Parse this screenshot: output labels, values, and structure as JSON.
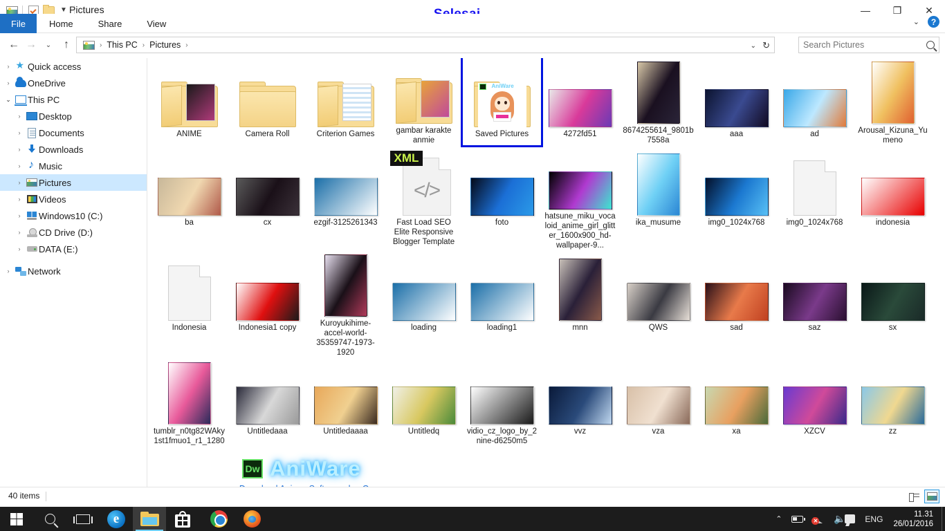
{
  "window": {
    "title": "Pictures",
    "overlay_annotation": "Selesai .......",
    "overlay_color": "#1510f0",
    "quick_access_icons": [
      "pictures-icon",
      "checklist-icon",
      "folder-icon",
      "dropdown-caret"
    ],
    "controls": {
      "minimize": "—",
      "maximize": "❐",
      "close": "✕"
    }
  },
  "ribbon": {
    "tabs": [
      {
        "label": "File",
        "active": true
      },
      {
        "label": "Home",
        "active": false
      },
      {
        "label": "Share",
        "active": false
      },
      {
        "label": "View",
        "active": false
      }
    ],
    "collapse_caret": "⌄",
    "help_label": "?"
  },
  "addressbar": {
    "back": "←",
    "forward": "→",
    "recent": "⌄",
    "up": "↑",
    "crumbs": [
      "This PC",
      "Pictures"
    ],
    "separator": "›",
    "dropdown_caret": "⌄",
    "refresh": "↻"
  },
  "search": {
    "placeholder": "Search Pictures",
    "value": "",
    "icon": "search-icon"
  },
  "sidebar": {
    "items": [
      {
        "label": "Quick access",
        "level": 1,
        "arrow": "›",
        "icon": "star-icon",
        "selected": false
      },
      {
        "label": "OneDrive",
        "level": 1,
        "arrow": "›",
        "icon": "cloud-icon",
        "selected": false
      },
      {
        "label": "This PC",
        "level": 1,
        "arrow": "⌄",
        "icon": "computer-icon",
        "selected": false,
        "expanded": true
      },
      {
        "label": "Desktop",
        "level": 2,
        "arrow": "›",
        "icon": "desktop-icon",
        "selected": false
      },
      {
        "label": "Documents",
        "level": 2,
        "arrow": "›",
        "icon": "documents-icon",
        "selected": false
      },
      {
        "label": "Downloads",
        "level": 2,
        "arrow": "›",
        "icon": "downloads-icon",
        "selected": false
      },
      {
        "label": "Music",
        "level": 2,
        "arrow": "›",
        "icon": "music-icon",
        "selected": false
      },
      {
        "label": "Pictures",
        "level": 2,
        "arrow": "›",
        "icon": "pictures-icon",
        "selected": true
      },
      {
        "label": "Videos",
        "level": 2,
        "arrow": "›",
        "icon": "videos-icon",
        "selected": false
      },
      {
        "label": "Windows10 (C:)",
        "level": 2,
        "arrow": "›",
        "icon": "windows-drive-icon",
        "selected": false
      },
      {
        "label": "CD Drive (D:)",
        "level": 2,
        "arrow": "›",
        "icon": "cd-drive-icon",
        "selected": false
      },
      {
        "label": "DATA (E:)",
        "level": 2,
        "arrow": "›",
        "icon": "hard-drive-icon",
        "selected": false
      },
      {
        "label": "Network",
        "level": 1,
        "arrow": "›",
        "icon": "network-icon",
        "selected": false,
        "spaced": true
      }
    ]
  },
  "files": {
    "rows": [
      [
        {
          "name": "ANIME",
          "type": "folder",
          "variant": "open-image",
          "colors": [
            "#1a1a1a",
            "#b03a7a"
          ]
        },
        {
          "name": "Camera Roll",
          "type": "folder",
          "variant": "empty",
          "colors": []
        },
        {
          "name": "Criterion Games",
          "type": "folder",
          "variant": "docs",
          "colors": [
            "#ffffff",
            "#2b86d4"
          ]
        },
        {
          "name": "gambar karakte anmie",
          "type": "folder",
          "variant": "open-image",
          "colors": [
            "#e8a33a",
            "#c04a9a"
          ]
        },
        {
          "name": "Saved Pictures",
          "type": "folder",
          "variant": "thumbnail-umaru",
          "selected": true,
          "colors": [
            "#ffffff",
            "#e89a5a"
          ]
        },
        {
          "name": "4272fd51",
          "type": "image",
          "colors": [
            "#e8e8e8",
            "#d93a9a",
            "#6a3ab5"
          ]
        },
        {
          "name": "8674255614_9801b7558a",
          "type": "image",
          "tall": true,
          "colors": [
            "#d8c8a8",
            "#1a1020",
            "#2a2438"
          ]
        },
        {
          "name": "aaa",
          "type": "image",
          "colors": [
            "#0c1430",
            "#3a4a90",
            "#120a22"
          ]
        },
        {
          "name": "ad",
          "type": "image",
          "colors": [
            "#3aa8e8",
            "#bde8ff",
            "#e07a3a"
          ]
        },
        {
          "name": "Arousal_Kizuna_Yumeno",
          "type": "image",
          "tall": true,
          "colors": [
            "#ffffff",
            "#f0c060",
            "#e06030"
          ]
        }
      ],
      [
        {
          "name": "ba",
          "type": "image",
          "colors": [
            "#c8b89a",
            "#f0d8b0",
            "#b05a4a"
          ]
        },
        {
          "name": "cx",
          "type": "image",
          "colors": [
            "#5a5a5a",
            "#1a1018",
            "#3a3038"
          ]
        },
        {
          "name": "ezgif-3125261343",
          "type": "image",
          "colors": [
            "#1b6fa8",
            "#ffffff"
          ]
        },
        {
          "name": "Fast Load SEO Elite Responsive Blogger Template",
          "type": "xml",
          "colors": [
            "#f2f2f2",
            "#111111",
            "#c8f04a"
          ]
        },
        {
          "name": "foto",
          "type": "image",
          "colors": [
            "#050a18",
            "#1b6fd6",
            "#2b9ae8"
          ]
        },
        {
          "name": "hatsune_miku_vocaloid_anime_girl_glitter_1600x900_hd-wallpaper-9...",
          "type": "image",
          "colors": [
            "#000000",
            "#b03ad0",
            "#3ae8d0"
          ]
        },
        {
          "name": "ika_musume",
          "type": "image",
          "tall": true,
          "colors": [
            "#ffffff",
            "#6fd0f5",
            "#2b86d4"
          ]
        },
        {
          "name": "img0_1024x768",
          "type": "image",
          "colors": [
            "#03102a",
            "#1b78d0",
            "#58c0f5"
          ]
        },
        {
          "name": "img0_1024x768",
          "type": "page",
          "colors": [
            "#f4f4f4"
          ]
        },
        {
          "name": "indonesia",
          "type": "image",
          "colors": [
            "#ffffff",
            "#e80000"
          ]
        }
      ],
      [
        {
          "name": "Indonesia",
          "type": "page",
          "colors": [
            "#f4f4f4"
          ]
        },
        {
          "name": "Indonesia1 copy",
          "type": "image",
          "colors": [
            "#ffffff",
            "#e01010",
            "#1a1a1a"
          ]
        },
        {
          "name": "Kuroyukihime-accel-world-35359747-1973-1920",
          "type": "image",
          "tall": true,
          "colors": [
            "#e8e0f0",
            "#1a1018",
            "#b03a5a"
          ]
        },
        {
          "name": "loading",
          "type": "image",
          "colors": [
            "#1b6fa8",
            "#ffffff"
          ]
        },
        {
          "name": "loading1",
          "type": "image",
          "colors": [
            "#1b6fa8",
            "#ffffff"
          ]
        },
        {
          "name": "mnn",
          "type": "image",
          "tall": true,
          "colors": [
            "#c8c0b8",
            "#2a2038",
            "#8a5a4a"
          ]
        },
        {
          "name": "QWS",
          "type": "image",
          "colors": [
            "#d8d0c8",
            "#3a3a42",
            "#e8e0d8"
          ]
        },
        {
          "name": "sad",
          "type": "image",
          "colors": [
            "#2a1018",
            "#e87a4a",
            "#c04020"
          ]
        },
        {
          "name": "saz",
          "type": "image",
          "colors": [
            "#1a0a20",
            "#7a3a8a",
            "#2a1030"
          ]
        },
        {
          "name": "sx",
          "type": "image",
          "colors": [
            "#0a1818",
            "#2a4a3a",
            "#1a2a28"
          ]
        }
      ],
      [
        {
          "name": "tumblr_n0tg82WAky1st1fmuo1_r1_1280",
          "type": "image",
          "tall": true,
          "colors": [
            "#ffffff",
            "#e85a9a",
            "#2a2a5a"
          ]
        },
        {
          "name": "Untitledaaa",
          "type": "image",
          "colors": [
            "#2a2a3a",
            "#d8d8d8",
            "#9a9a9a"
          ]
        },
        {
          "name": "Untitledaaaa",
          "type": "image",
          "colors": [
            "#e8a85a",
            "#f0d090",
            "#3a2a20"
          ]
        },
        {
          "name": "Untitledq",
          "type": "image",
          "colors": [
            "#f0f0e8",
            "#d8c860",
            "#4a8a3a"
          ]
        },
        {
          "name": "vidio_cz_logo_by_2nine-d6250m5",
          "type": "image",
          "colors": [
            "#ffffff",
            "#1a1a1a"
          ]
        },
        {
          "name": "vvz",
          "type": "image",
          "colors": [
            "#0a1a3a",
            "#2a4a7a",
            "#c0d8f0"
          ]
        },
        {
          "name": "vza",
          "type": "image",
          "colors": [
            "#d8c0a8",
            "#f0e0d0",
            "#8a6a5a"
          ]
        },
        {
          "name": "xa",
          "type": "image",
          "colors": [
            "#c8d8b0",
            "#e8a060",
            "#4a6a3a"
          ]
        },
        {
          "name": "XZCV",
          "type": "image",
          "colors": [
            "#6a3ad0",
            "#d04a9a",
            "#3a2a8a"
          ]
        },
        {
          "name": "zz",
          "type": "image",
          "colors": [
            "#8ac8e8",
            "#f0d890",
            "#2a6a9a"
          ]
        }
      ]
    ]
  },
  "watermark": {
    "badge": "Dw",
    "name": "AniWare",
    "subtitle": "Download Anime ,Software,dan Games"
  },
  "statusbar": {
    "item_count": "40 items",
    "view_buttons": [
      {
        "name": "details-view",
        "active": false
      },
      {
        "name": "large-icons-view",
        "active": true
      }
    ]
  },
  "taskbar": {
    "buttons": [
      {
        "name": "start-button",
        "icon": "windows-logo-icon",
        "active": false
      },
      {
        "name": "search-button",
        "icon": "search-icon",
        "active": false
      },
      {
        "name": "task-view-button",
        "icon": "task-view-icon",
        "active": false
      },
      {
        "name": "edge-button",
        "icon": "edge-icon",
        "active": false
      },
      {
        "name": "file-explorer-button",
        "icon": "folder-icon",
        "active": true
      },
      {
        "name": "store-button",
        "icon": "store-icon",
        "active": false
      },
      {
        "name": "chrome-button",
        "icon": "chrome-icon",
        "active": false
      },
      {
        "name": "firefox-button",
        "icon": "firefox-icon",
        "active": false
      }
    ],
    "tray": {
      "show_hidden": "⌃",
      "battery": "battery-icon",
      "network": "network-error-icon",
      "volume": "🔊",
      "action_center": "action-center-icon",
      "language": "ENG",
      "time": "11.31",
      "date": "26/01/2016"
    }
  }
}
